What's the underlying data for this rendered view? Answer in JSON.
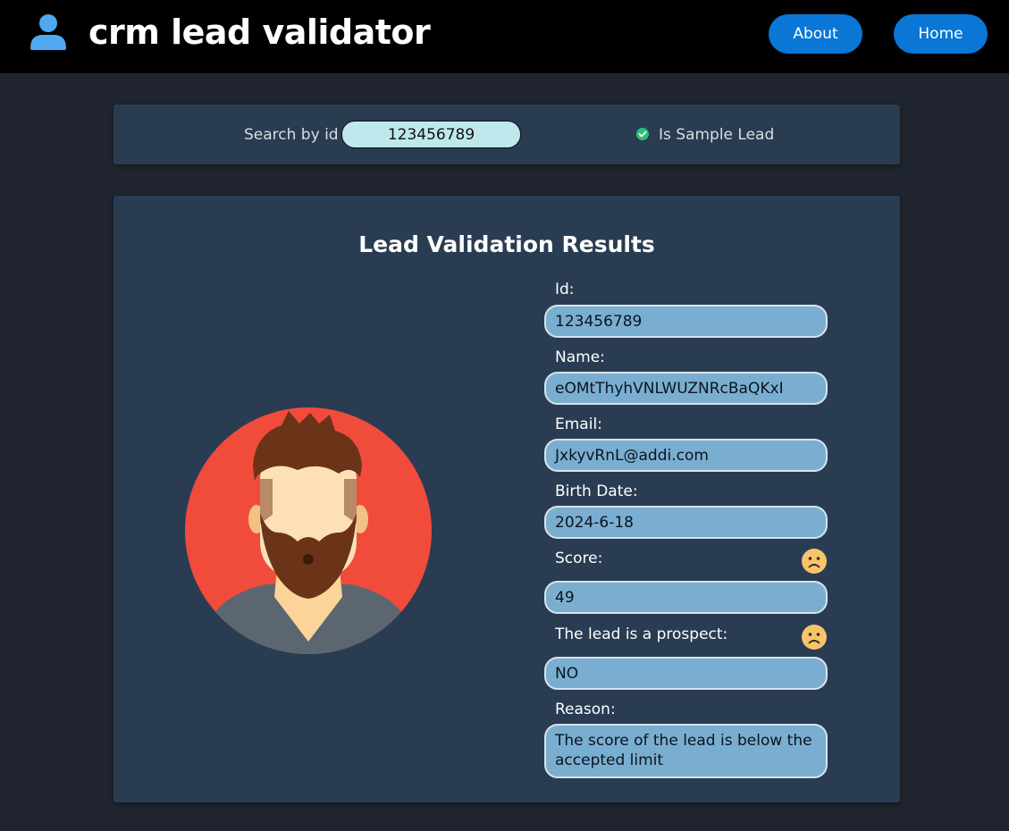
{
  "header": {
    "title": "crm lead validator",
    "about_label": "About",
    "home_label": "Home"
  },
  "search": {
    "label": "Search by id",
    "value": "123456789",
    "sample_label": "Is Sample Lead",
    "sample_checked": true
  },
  "results": {
    "title": "Lead Validation Results",
    "fields": [
      {
        "label": "Id:",
        "value": "123456789"
      },
      {
        "label": "Name:",
        "value": "eOMtThyhVNLWUZNRcBaQKxI"
      },
      {
        "label": "Email:",
        "value": "JxkyvRnL@addi.com"
      },
      {
        "label": "Birth Date:",
        "value": "2024-6-18"
      },
      {
        "label": "Score:",
        "value": "49",
        "icon": "sad-face-icon"
      },
      {
        "label": "The lead is a prospect:",
        "value": "NO",
        "icon": "sad-face-icon"
      },
      {
        "label": "Reason:",
        "value": "The score of the lead is below the accepted limit"
      }
    ]
  },
  "colors": {
    "header_bg": "#000000",
    "page_bg": "#1f242e",
    "panel_bg": "#293c52",
    "accent_button": "#0a76d6",
    "field_bg": "#7aaed0",
    "search_bg": "#bfe8ec",
    "check": "#2fbf71",
    "avatar_bg": "#f14b3c"
  }
}
